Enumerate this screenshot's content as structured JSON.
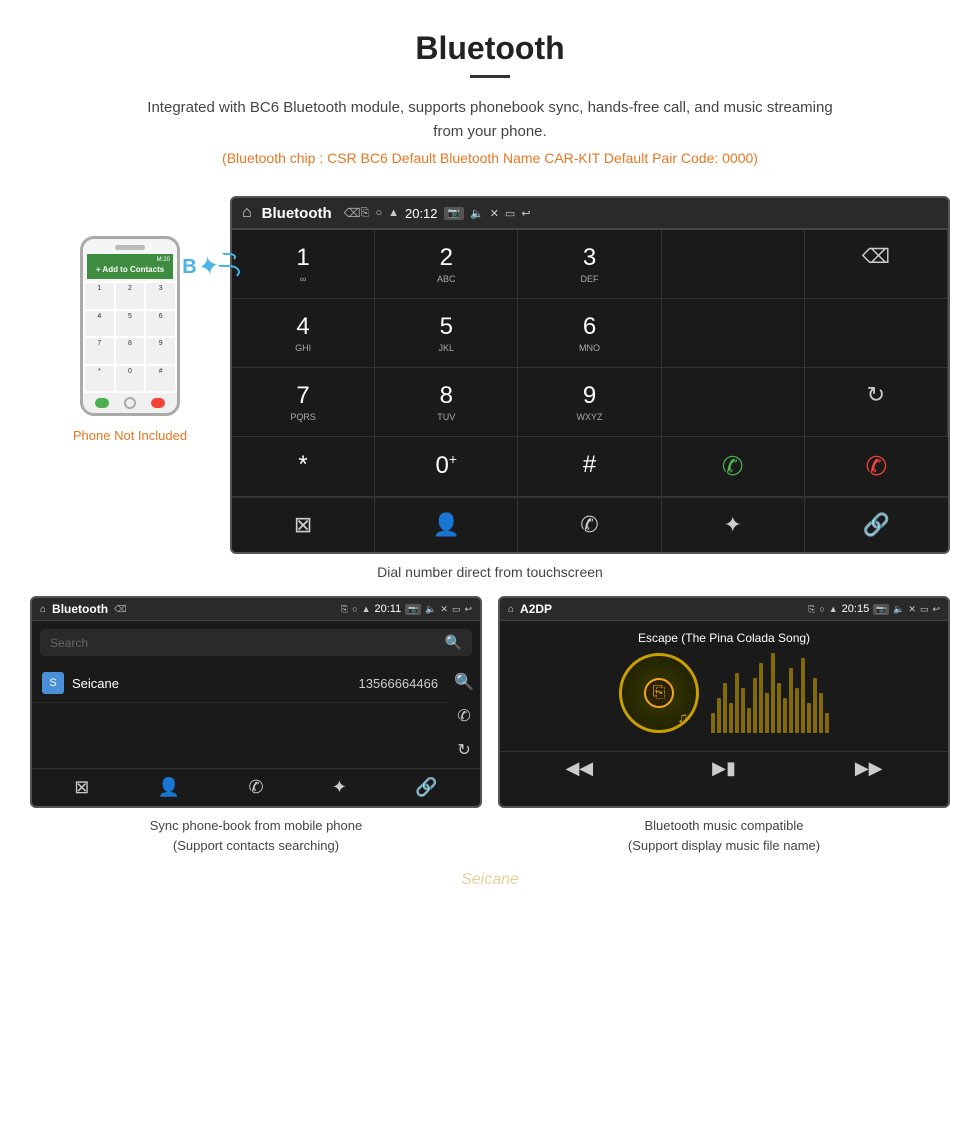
{
  "header": {
    "title": "Bluetooth",
    "description": "Integrated with BC6 Bluetooth module, supports phonebook sync, hands-free call, and music streaming from your phone.",
    "specs": "(Bluetooth chip : CSR BC6   Default Bluetooth Name CAR-KIT    Default Pair Code: 0000)"
  },
  "phone_illustration": {
    "not_included_label": "Phone Not Included"
  },
  "dial_screen": {
    "top_bar": {
      "title": "Bluetooth",
      "time": "20:12"
    },
    "keys": [
      {
        "number": "1",
        "letters": "∞"
      },
      {
        "number": "2",
        "letters": "ABC"
      },
      {
        "number": "3",
        "letters": "DEF"
      },
      {
        "number": "",
        "letters": ""
      },
      {
        "number": "⌫",
        "letters": ""
      },
      {
        "number": "4",
        "letters": "GHI"
      },
      {
        "number": "5",
        "letters": "JKL"
      },
      {
        "number": "6",
        "letters": "MNO"
      },
      {
        "number": "",
        "letters": ""
      },
      {
        "number": "",
        "letters": ""
      },
      {
        "number": "7",
        "letters": "PQRS"
      },
      {
        "number": "8",
        "letters": "TUV"
      },
      {
        "number": "9",
        "letters": "WXYZ"
      },
      {
        "number": "",
        "letters": ""
      },
      {
        "number": "↻",
        "letters": ""
      },
      {
        "number": "*",
        "letters": ""
      },
      {
        "number": "0",
        "letters": "+"
      },
      {
        "number": "#",
        "letters": ""
      },
      {
        "number": "✆",
        "letters": "green"
      },
      {
        "number": "✆",
        "letters": "red"
      }
    ],
    "bottom_icons": [
      "⊞",
      "👤",
      "📞",
      "✱",
      "🔗"
    ]
  },
  "dial_caption": "Dial number direct from touchscreen",
  "phonebook_screen": {
    "top_bar": {
      "title": "Bluetooth",
      "time": "20:11"
    },
    "search_placeholder": "Search",
    "contact": {
      "initial": "S",
      "name": "Seicane",
      "number": "13566664466"
    },
    "caption_line1": "Sync phone-book from mobile phone",
    "caption_line2": "(Support contacts searching)"
  },
  "music_screen": {
    "top_bar": {
      "title": "A2DP",
      "time": "20:15"
    },
    "song_title": "Escape (The Pina Colada Song)",
    "caption_line1": "Bluetooth music compatible",
    "caption_line2": "(Support display music file name)"
  },
  "watermark": "Seicane"
}
